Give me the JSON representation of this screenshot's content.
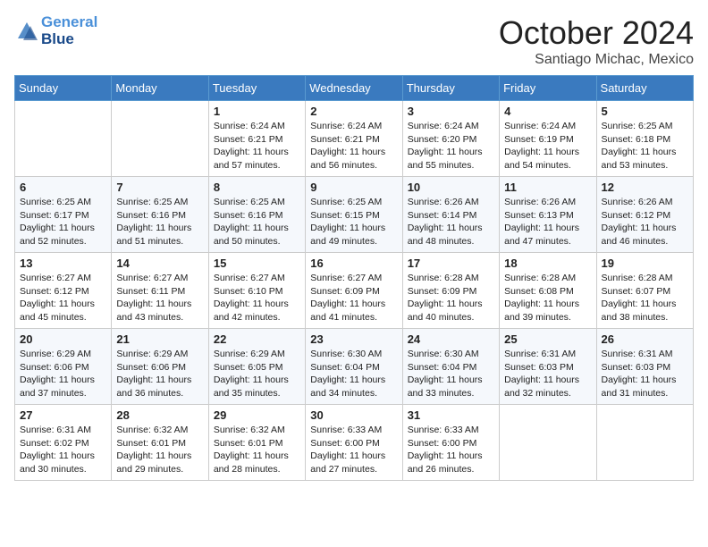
{
  "header": {
    "logo_line1": "General",
    "logo_line2": "Blue",
    "month": "October 2024",
    "location": "Santiago Michac, Mexico"
  },
  "weekdays": [
    "Sunday",
    "Monday",
    "Tuesday",
    "Wednesday",
    "Thursday",
    "Friday",
    "Saturday"
  ],
  "weeks": [
    [
      {
        "day": "",
        "info": ""
      },
      {
        "day": "",
        "info": ""
      },
      {
        "day": "1",
        "info": "Sunrise: 6:24 AM\nSunset: 6:21 PM\nDaylight: 11 hours and 57 minutes."
      },
      {
        "day": "2",
        "info": "Sunrise: 6:24 AM\nSunset: 6:21 PM\nDaylight: 11 hours and 56 minutes."
      },
      {
        "day": "3",
        "info": "Sunrise: 6:24 AM\nSunset: 6:20 PM\nDaylight: 11 hours and 55 minutes."
      },
      {
        "day": "4",
        "info": "Sunrise: 6:24 AM\nSunset: 6:19 PM\nDaylight: 11 hours and 54 minutes."
      },
      {
        "day": "5",
        "info": "Sunrise: 6:25 AM\nSunset: 6:18 PM\nDaylight: 11 hours and 53 minutes."
      }
    ],
    [
      {
        "day": "6",
        "info": "Sunrise: 6:25 AM\nSunset: 6:17 PM\nDaylight: 11 hours and 52 minutes."
      },
      {
        "day": "7",
        "info": "Sunrise: 6:25 AM\nSunset: 6:16 PM\nDaylight: 11 hours and 51 minutes."
      },
      {
        "day": "8",
        "info": "Sunrise: 6:25 AM\nSunset: 6:16 PM\nDaylight: 11 hours and 50 minutes."
      },
      {
        "day": "9",
        "info": "Sunrise: 6:25 AM\nSunset: 6:15 PM\nDaylight: 11 hours and 49 minutes."
      },
      {
        "day": "10",
        "info": "Sunrise: 6:26 AM\nSunset: 6:14 PM\nDaylight: 11 hours and 48 minutes."
      },
      {
        "day": "11",
        "info": "Sunrise: 6:26 AM\nSunset: 6:13 PM\nDaylight: 11 hours and 47 minutes."
      },
      {
        "day": "12",
        "info": "Sunrise: 6:26 AM\nSunset: 6:12 PM\nDaylight: 11 hours and 46 minutes."
      }
    ],
    [
      {
        "day": "13",
        "info": "Sunrise: 6:27 AM\nSunset: 6:12 PM\nDaylight: 11 hours and 45 minutes."
      },
      {
        "day": "14",
        "info": "Sunrise: 6:27 AM\nSunset: 6:11 PM\nDaylight: 11 hours and 43 minutes."
      },
      {
        "day": "15",
        "info": "Sunrise: 6:27 AM\nSunset: 6:10 PM\nDaylight: 11 hours and 42 minutes."
      },
      {
        "day": "16",
        "info": "Sunrise: 6:27 AM\nSunset: 6:09 PM\nDaylight: 11 hours and 41 minutes."
      },
      {
        "day": "17",
        "info": "Sunrise: 6:28 AM\nSunset: 6:09 PM\nDaylight: 11 hours and 40 minutes."
      },
      {
        "day": "18",
        "info": "Sunrise: 6:28 AM\nSunset: 6:08 PM\nDaylight: 11 hours and 39 minutes."
      },
      {
        "day": "19",
        "info": "Sunrise: 6:28 AM\nSunset: 6:07 PM\nDaylight: 11 hours and 38 minutes."
      }
    ],
    [
      {
        "day": "20",
        "info": "Sunrise: 6:29 AM\nSunset: 6:06 PM\nDaylight: 11 hours and 37 minutes."
      },
      {
        "day": "21",
        "info": "Sunrise: 6:29 AM\nSunset: 6:06 PM\nDaylight: 11 hours and 36 minutes."
      },
      {
        "day": "22",
        "info": "Sunrise: 6:29 AM\nSunset: 6:05 PM\nDaylight: 11 hours and 35 minutes."
      },
      {
        "day": "23",
        "info": "Sunrise: 6:30 AM\nSunset: 6:04 PM\nDaylight: 11 hours and 34 minutes."
      },
      {
        "day": "24",
        "info": "Sunrise: 6:30 AM\nSunset: 6:04 PM\nDaylight: 11 hours and 33 minutes."
      },
      {
        "day": "25",
        "info": "Sunrise: 6:31 AM\nSunset: 6:03 PM\nDaylight: 11 hours and 32 minutes."
      },
      {
        "day": "26",
        "info": "Sunrise: 6:31 AM\nSunset: 6:03 PM\nDaylight: 11 hours and 31 minutes."
      }
    ],
    [
      {
        "day": "27",
        "info": "Sunrise: 6:31 AM\nSunset: 6:02 PM\nDaylight: 11 hours and 30 minutes."
      },
      {
        "day": "28",
        "info": "Sunrise: 6:32 AM\nSunset: 6:01 PM\nDaylight: 11 hours and 29 minutes."
      },
      {
        "day": "29",
        "info": "Sunrise: 6:32 AM\nSunset: 6:01 PM\nDaylight: 11 hours and 28 minutes."
      },
      {
        "day": "30",
        "info": "Sunrise: 6:33 AM\nSunset: 6:00 PM\nDaylight: 11 hours and 27 minutes."
      },
      {
        "day": "31",
        "info": "Sunrise: 6:33 AM\nSunset: 6:00 PM\nDaylight: 11 hours and 26 minutes."
      },
      {
        "day": "",
        "info": ""
      },
      {
        "day": "",
        "info": ""
      }
    ]
  ]
}
